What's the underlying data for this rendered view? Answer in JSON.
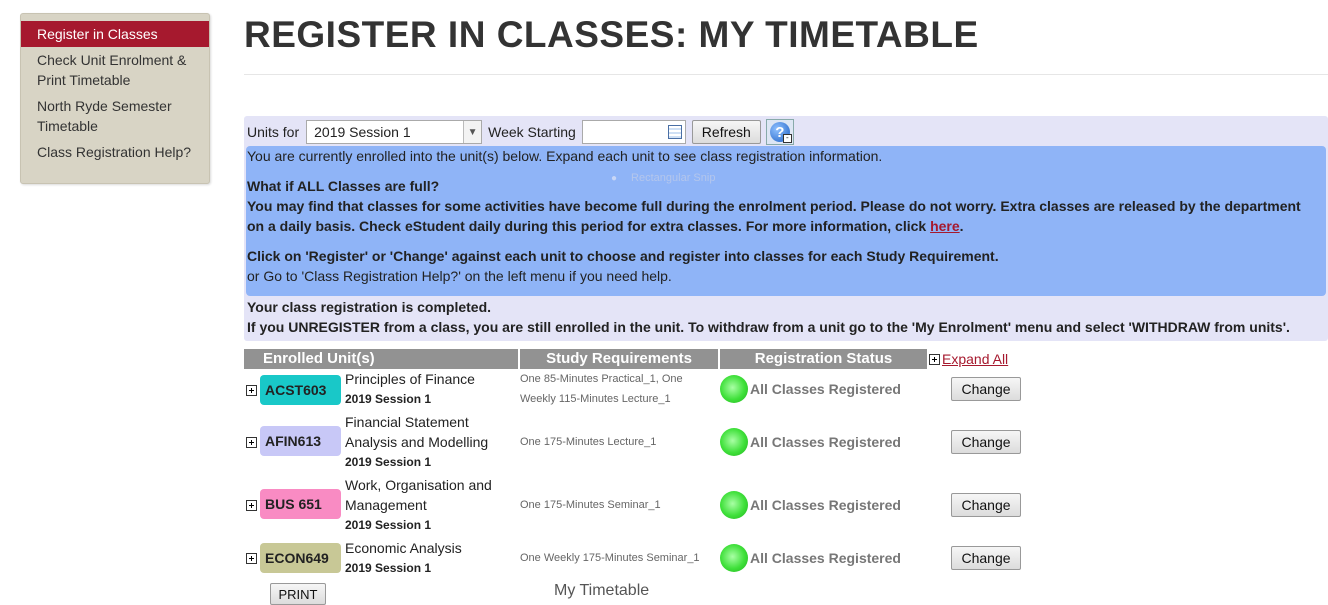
{
  "sidebar": {
    "items": [
      {
        "label": "Register in Classes"
      },
      {
        "label": "Check Unit Enrolment & Print Timetable"
      },
      {
        "label": "North Ryde Semester Timetable"
      },
      {
        "label": "Class Registration Help?"
      }
    ]
  },
  "page": {
    "title": "REGISTER IN CLASSES: MY TIMETABLE"
  },
  "toolbar": {
    "units_for_label": "Units for",
    "session_value": "2019 Session 1",
    "week_starting_label": "Week Starting",
    "week_starting_value": "",
    "refresh_label": "Refresh",
    "help_glyph": "?"
  },
  "info": {
    "line1": "You are currently enrolled into the unit(s) below. Expand each unit to see class registration information.",
    "snip_overlay": "Rectangular Snip",
    "full_heading": "What if ALL Classes are full?",
    "full_text": "You may find that classes for some activities have become full during the enrolment period. Please do not worry. Extra classes are released by the department on a daily basis. Check eStudent daily during this period for extra classes. For more information, click",
    "here_link": "here",
    "period": ".",
    "register_instr": "Click on 'Register' or 'Change' against each unit to choose and register into classes for each Study Requirement.",
    "goto_help": "or Go to 'Class Registration Help?' on the left menu if you need help."
  },
  "completion": {
    "line1": "Your class registration is completed.",
    "line2": "If you UNREGISTER from a class, you are still enrolled in the unit. To withdraw from a unit go to the 'My Enrolment' menu and select 'WITHDRAW from units'."
  },
  "table": {
    "headers": {
      "enrolled": "Enrolled Unit(s)",
      "requirements": "Study Requirements",
      "status": "Registration Status"
    },
    "expand_all": "Expand All",
    "rows": [
      {
        "code": "ACST603",
        "color": "#19c8c8",
        "name": "Principles of Finance",
        "session": "2019 Session 1",
        "req": "One 85-Minutes Practical_1, One Weekly 115-Minutes Lecture_1",
        "status": "All Classes Registered",
        "action": "Change"
      },
      {
        "code": "AFIN613",
        "color": "#c8c8f7",
        "name": "Financial Statement Analysis and Modelling",
        "session": "2019 Session 1",
        "req": "One 175-Minutes Lecture_1",
        "status": "All Classes Registered",
        "action": "Change"
      },
      {
        "code": "BUS 651",
        "color": "#f98bc3",
        "name": "Work, Organisation and Management",
        "session": "2019 Session 1",
        "req": "One 175-Minutes Seminar_1",
        "status": "All Classes Registered",
        "action": "Change"
      },
      {
        "code": "ECON649",
        "color": "#c8c896",
        "name": "Economic Analysis",
        "session": "2019 Session 1",
        "req": "One Weekly 175-Minutes Seminar_1",
        "status": "All Classes Registered",
        "action": "Change"
      }
    ]
  },
  "footer": {
    "print_label": "PRINT",
    "timetable_heading": "My Timetable"
  },
  "colors": {
    "brand_red": "#a6192e",
    "info_blue": "#8fb4f7",
    "panel_lavender": "#e4e4f7",
    "header_gray": "#929292",
    "status_green": "#3fe03a"
  }
}
